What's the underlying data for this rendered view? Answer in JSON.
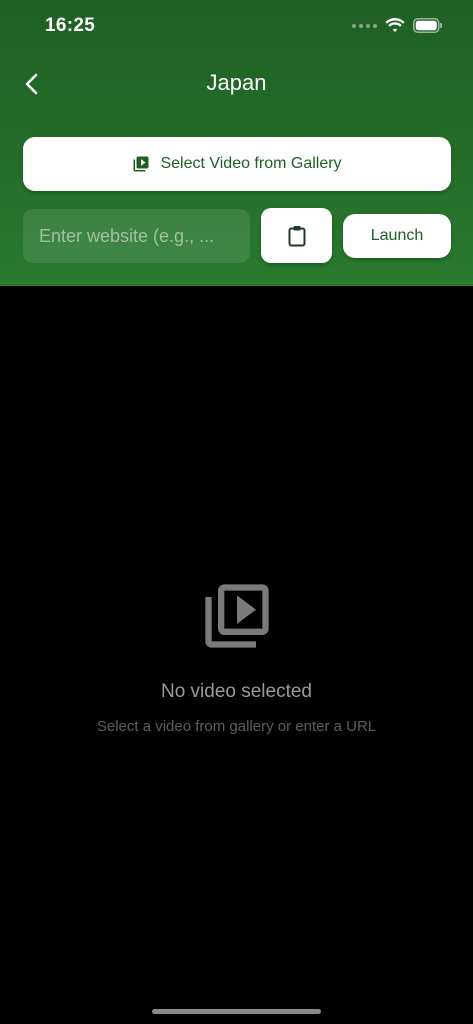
{
  "status_bar": {
    "time": "16:25",
    "icons": [
      "cellular-signal-icon",
      "wifi-icon",
      "battery-icon"
    ]
  },
  "nav": {
    "back_icon": "chevron-left-icon",
    "title": "Japan"
  },
  "controls": {
    "gallery_button_label": "Select Video from Gallery",
    "gallery_icon": "video-library-icon",
    "url_input_value": "",
    "url_input_placeholder": "Enter website (e.g., ...",
    "paste_icon": "clipboard-icon",
    "launch_label": "Launch"
  },
  "empty_state": {
    "icon": "video-library-icon",
    "title": "No video selected",
    "subtitle": "Select a video from gallery or enter a URL"
  },
  "colors": {
    "header_top": "#1f5f23",
    "header_bottom": "#2a7a2f",
    "accent_text": "#1f5f23",
    "background": "#000000"
  }
}
